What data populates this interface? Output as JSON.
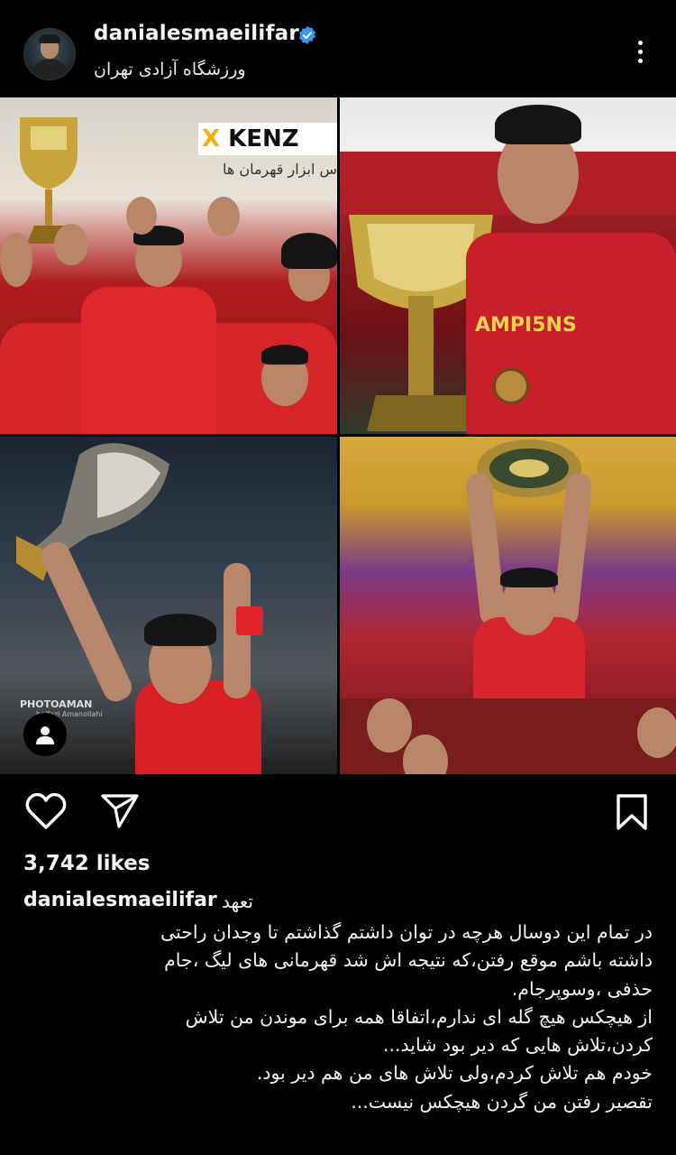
{
  "header": {
    "username": "danialesmaeilifar",
    "location": "ورزشگاه آزادی تهران",
    "verified_color": "#3897f0"
  },
  "post": {
    "photo1": {
      "sponsor_logo": "KENZ",
      "sponsor_logo_mark": "X",
      "banner_text": "س ابزار قهرمان ها"
    },
    "photo3": {
      "watermark": "PHOTOAMAN",
      "watermark_credit": "bolfazl Amanollahi"
    },
    "photos_count": 4
  },
  "actions": {
    "like_icon": "heart-icon",
    "share_icon": "send-icon",
    "save_icon": "bookmark-icon",
    "tag_icon": "user-tag-icon"
  },
  "likes": "3,742 likes",
  "caption": {
    "username": "danialesmaeilifar",
    "first_word": "تعهد",
    "lines": [
      "در تمام این دوسال هرچه در توان داشتم گذاشتم تا وجدان راحتی",
      "داشته باشم موقع رفتن،که نتیجه اش شد قهرمانی های لیگ ،جام",
      "حذفی ،وسوپرجام.",
      "از هیچکس هیچ گله ای ندارم،اتفاقا همه برای موندن من تلاش",
      "کردن،تلاش هایی که دیر بود شاید...",
      "خودم هم تلاش کردم،ولی تلاش های من هم دیر بود.",
      "تقصیر رفتن من گردن هیچکس نیست..."
    ]
  }
}
